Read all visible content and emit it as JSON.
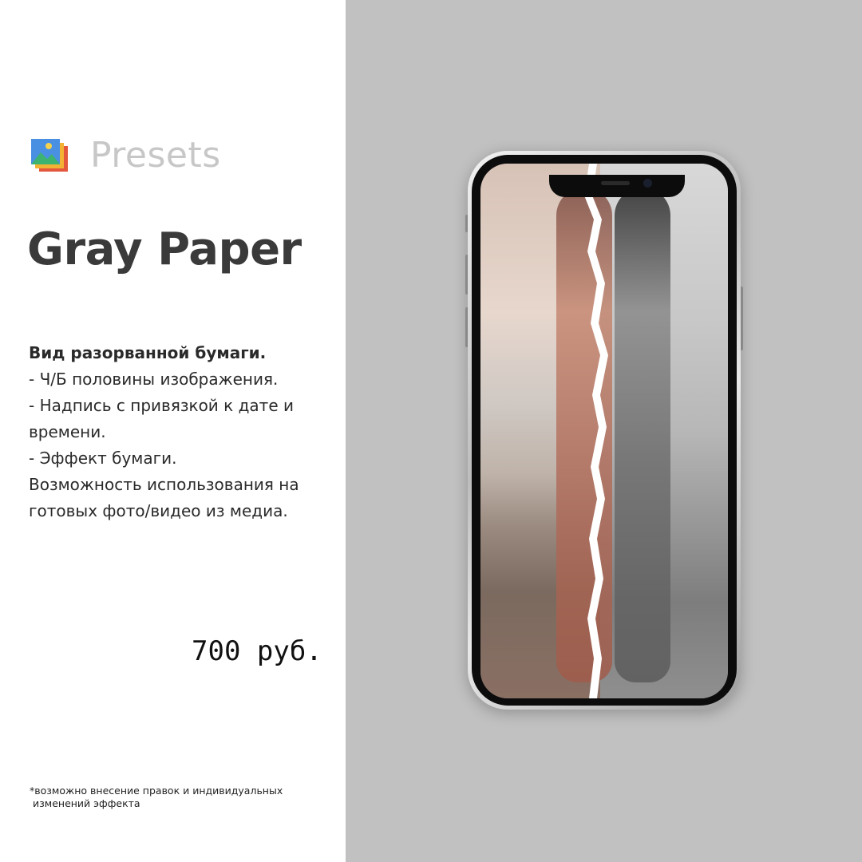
{
  "brand": {
    "name": "Presets",
    "icon": "presets-app-icon"
  },
  "title": "Gray Paper",
  "description": {
    "lines": [
      "Вид разорванной бумаги.",
      "- Ч/Б половины изображения.",
      "- Надпись с привязкой к дате и",
      "времени.",
      "- Эффект бумаги.",
      "Возможность использования на",
      "готовых фото/видео из медиа."
    ]
  },
  "price": "700 руб.",
  "footnote": {
    "lines": [
      "*возможно внесение правок и индивидуальных",
      "изменений эффекта"
    ]
  },
  "colors": {
    "left_bg": "#ffffff",
    "right_bg": "#c1c1c1",
    "title": "#3a3a3a",
    "brand_text": "#c7c7c7"
  }
}
